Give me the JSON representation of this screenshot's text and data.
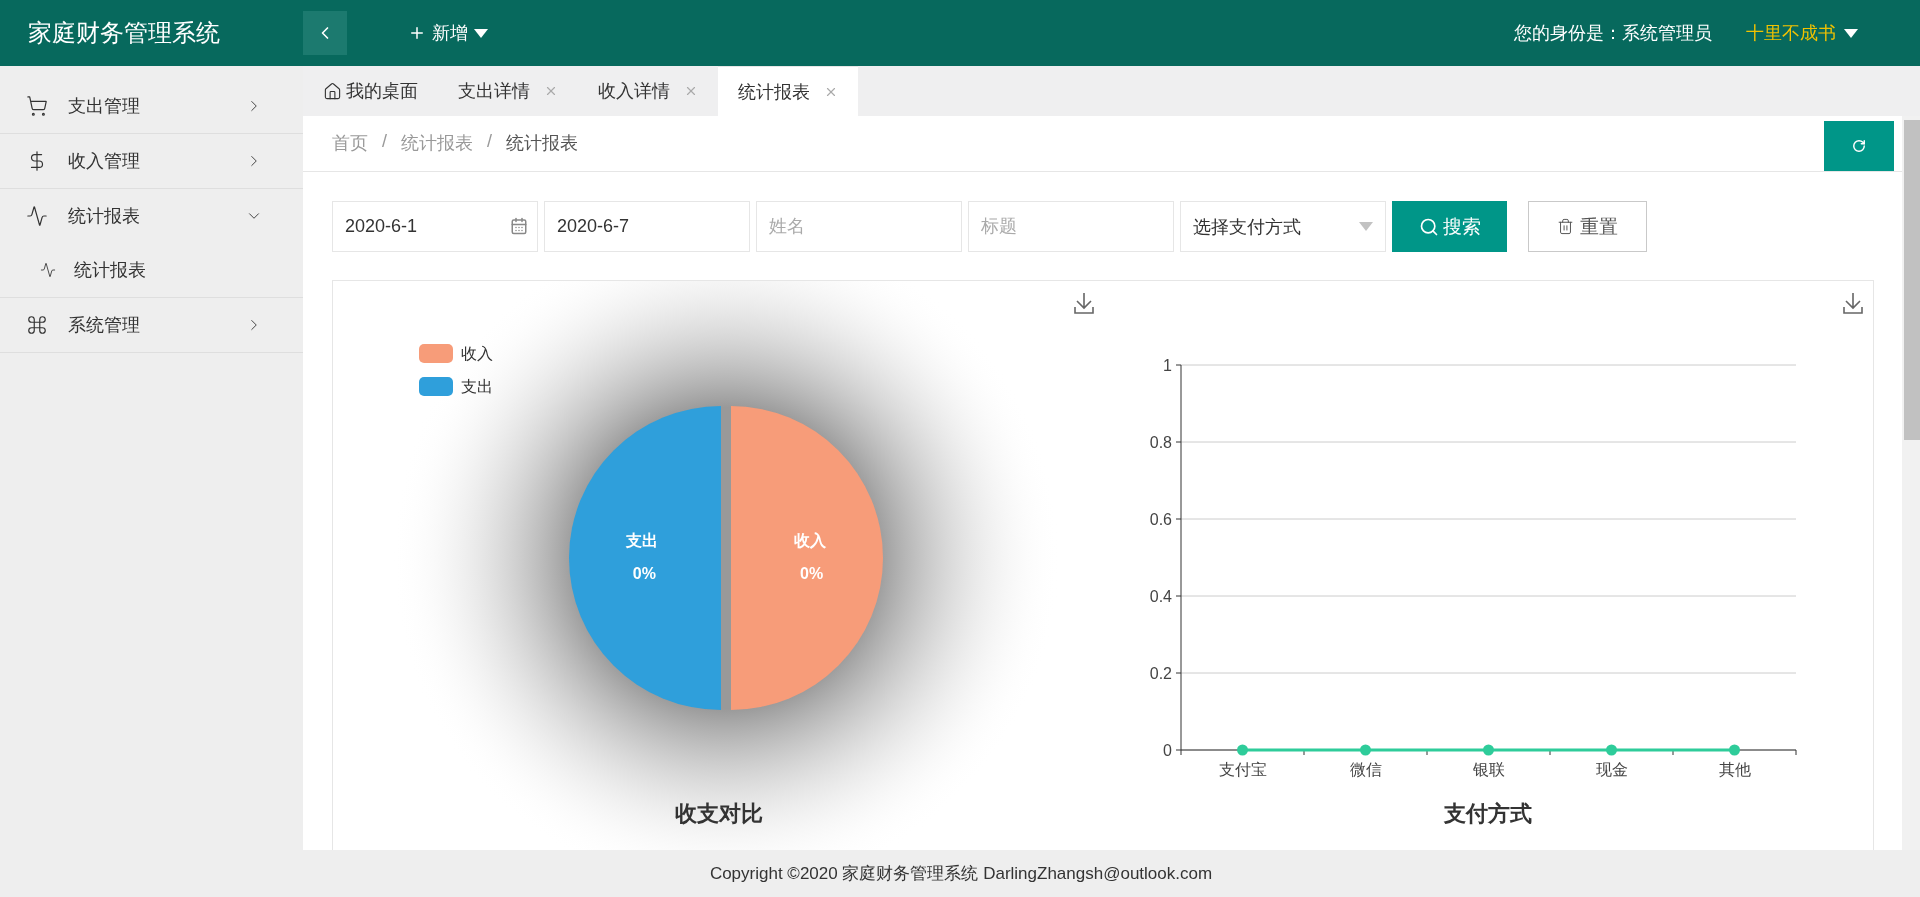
{
  "header": {
    "title": "家庭财务管理系统",
    "add_menu": "新增",
    "identity_label": "您的身份是：系统管理员",
    "user_name": "十里不成书"
  },
  "sidebar": {
    "items": [
      {
        "label": "支出管理",
        "expanded": false
      },
      {
        "label": "收入管理",
        "expanded": false
      },
      {
        "label": "统计报表",
        "expanded": true,
        "children": [
          {
            "label": "统计报表"
          }
        ]
      },
      {
        "label": "系统管理",
        "expanded": false
      }
    ]
  },
  "tabs": [
    {
      "label": "我的桌面",
      "selected": false,
      "closable": false
    },
    {
      "label": "支出详情",
      "selected": false,
      "closable": true
    },
    {
      "label": "收入详情",
      "selected": false,
      "closable": true
    },
    {
      "label": "统计报表",
      "selected": true,
      "closable": true
    }
  ],
  "breadcrumb": {
    "separator": "/",
    "items": [
      "首页",
      "统计报表",
      "统计报表"
    ]
  },
  "filters": {
    "start_date": "2020-6-1",
    "end_date": "2020-6-7",
    "name_placeholder": "姓名",
    "title_placeholder": "标题",
    "payment_select": "选择支付方式",
    "search_button": "搜索",
    "reset_button": "重置"
  },
  "pie_panel": {
    "legend": [
      {
        "label": "收入",
        "color": "#f79c79"
      },
      {
        "label": "支出",
        "color": "#2f9fdb"
      }
    ],
    "title": "收支对比",
    "slices": [
      {
        "label": "支出",
        "percent": "0%",
        "color": "#2f9fdb"
      },
      {
        "label": "收入",
        "percent": "0%",
        "color": "#f79c79"
      }
    ]
  },
  "line_panel": {
    "chart_data": {
      "type": "line",
      "title": "支付方式",
      "categories": [
        "支付宝",
        "微信",
        "银联",
        "现金",
        "其他"
      ],
      "series": [
        {
          "color": "#2ecc9a",
          "marker": true,
          "values": [
            0,
            0,
            0,
            0,
            0
          ]
        }
      ],
      "grid": true,
      "ylim": [
        0,
        1
      ],
      "yticks": [
        0,
        0.2,
        0.4,
        0.6,
        0.8,
        1
      ]
    }
  },
  "footer": "Copyright ©2020 家庭财务管理系统 DarlingZhangsh@outlook.com"
}
